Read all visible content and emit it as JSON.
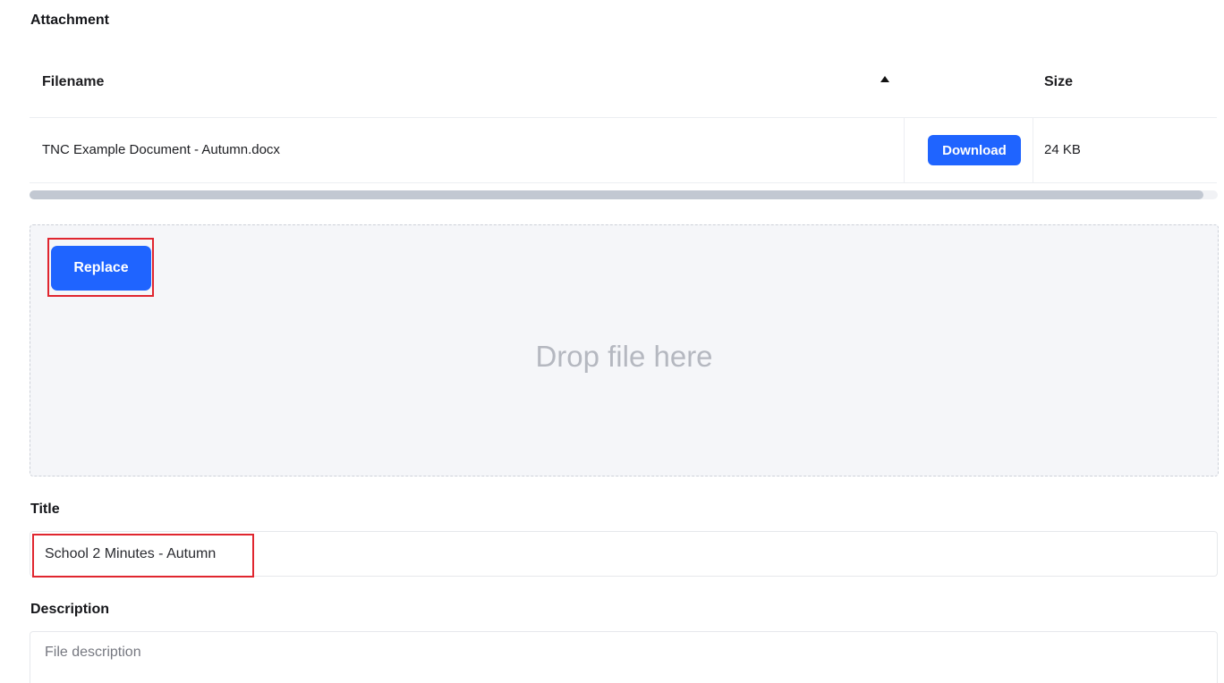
{
  "attachment": {
    "heading": "Attachment",
    "table": {
      "columns": {
        "filename": "Filename",
        "size": "Size"
      },
      "rows": [
        {
          "filename": "TNC Example Document - Autumn.docx",
          "action_label": "Download",
          "size": "24 KB"
        }
      ],
      "sort_icon": "sort-ascending-icon"
    }
  },
  "dropzone": {
    "replace_label": "Replace",
    "drop_text": "Drop file here"
  },
  "title_field": {
    "label": "Title",
    "value": "School 2 Minutes - Autumn"
  },
  "description_field": {
    "label": "Description",
    "placeholder": "File description"
  },
  "colors": {
    "accent": "#1f64ff",
    "highlight": "#e0262f"
  }
}
